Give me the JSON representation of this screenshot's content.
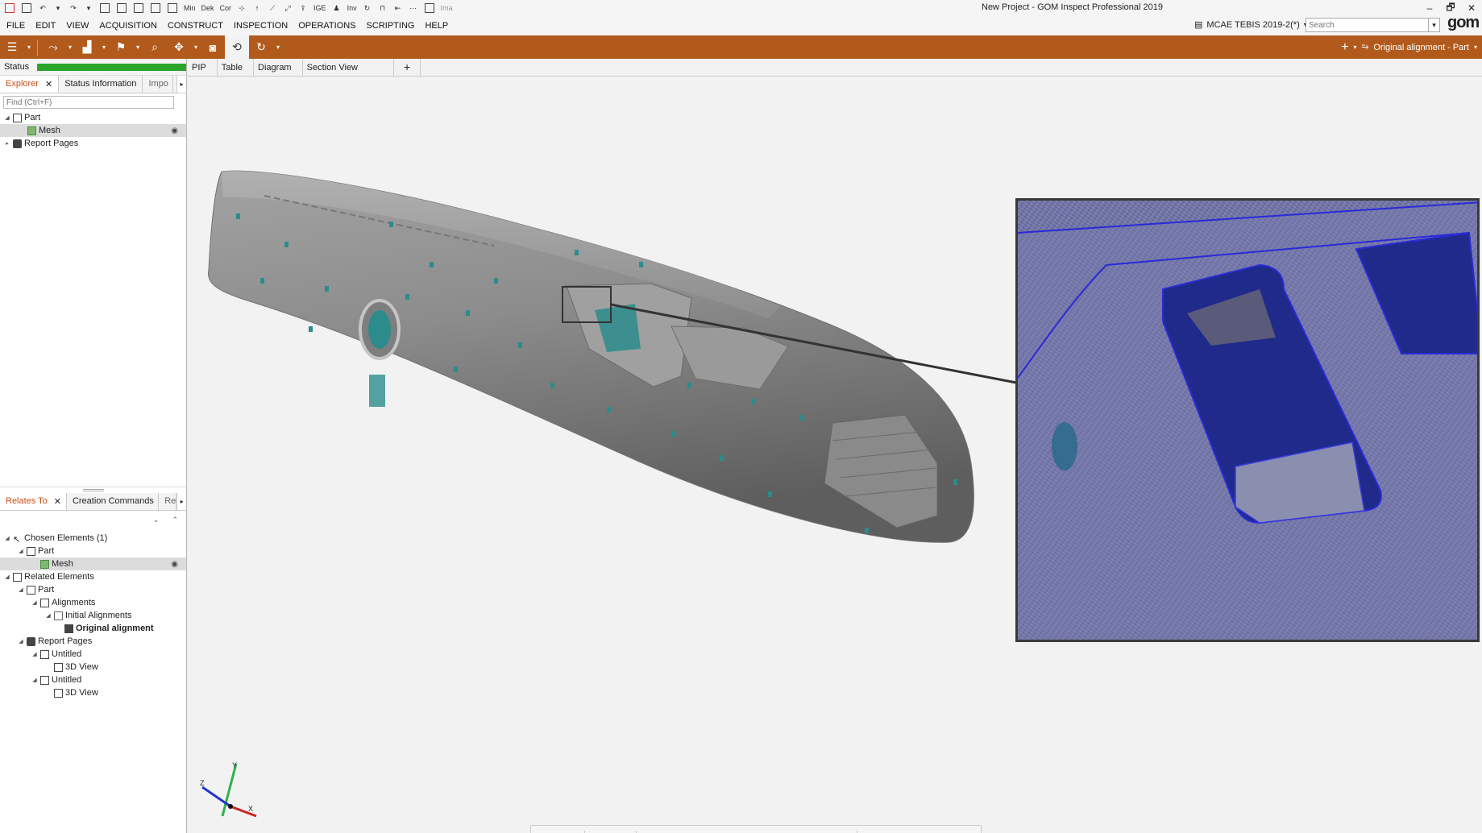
{
  "window": {
    "title": "New Project - GOM Inspect Professional 2019",
    "quick_access": [
      "Min",
      "Dek",
      "Cor",
      "IGE",
      "Inv",
      "Ima"
    ],
    "controls": [
      "–",
      "🗗",
      "✕"
    ]
  },
  "menu": [
    "FILE",
    "EDIT",
    "VIEW",
    "ACQUISITION",
    "CONSTRUCT",
    "INSPECTION",
    "OPERATIONS",
    "SCRIPTING",
    "HELP"
  ],
  "project": {
    "name": "MCAE TEBIS 2019-2(*)",
    "search_placeholder": "Search",
    "logo": "gom"
  },
  "toolbar": {
    "alignment": "Original alignment - Part"
  },
  "status": {
    "label": "Status",
    "progress": 1.0,
    "color": "#2aa52a"
  },
  "explorer": {
    "tabs": [
      "Explorer",
      "Status Information",
      "Impo"
    ],
    "find_placeholder": "Find (Ctrl+F)",
    "tree": [
      {
        "label": "Part",
        "level": 0,
        "icon": "part-icon",
        "expanded": true
      },
      {
        "label": "Mesh",
        "level": 1,
        "icon": "mesh-icon",
        "selected": true,
        "visible": true
      },
      {
        "label": "Report Pages",
        "level": 0,
        "icon": "camera-icon",
        "expanded": false
      }
    ]
  },
  "relates": {
    "tabs": [
      "Relates To",
      "Creation Commands",
      "Re"
    ],
    "tree": [
      {
        "label": "Chosen Elements (1)",
        "level": 0,
        "icon": "cursor-icon",
        "expanded": true
      },
      {
        "label": "Part",
        "level": 1,
        "icon": "part-icon",
        "expanded": true
      },
      {
        "label": "Mesh",
        "level": 2,
        "icon": "mesh-icon",
        "selected": true,
        "visible": true
      },
      {
        "label": "Related Elements",
        "level": 0,
        "icon": "hierarchy-icon",
        "expanded": true
      },
      {
        "label": "Part",
        "level": 1,
        "icon": "part-icon",
        "expanded": true
      },
      {
        "label": "Alignments",
        "level": 2,
        "icon": "alignment-icon",
        "expanded": true
      },
      {
        "label": "Initial Alignments",
        "level": 3,
        "icon": "folder-icon",
        "expanded": true
      },
      {
        "label": "Original alignment",
        "level": 4,
        "icon": "check-icon",
        "bold": true
      },
      {
        "label": "Report Pages",
        "level": 1,
        "icon": "camera-icon",
        "expanded": true
      },
      {
        "label": "Untitled",
        "level": 2,
        "icon": "page-icon",
        "expanded": true
      },
      {
        "label": "3D View",
        "level": 3,
        "icon": "view-icon"
      },
      {
        "label": "Untitled",
        "level": 2,
        "icon": "page-icon",
        "expanded": true
      },
      {
        "label": "3D View",
        "level": 3,
        "icon": "view-icon"
      }
    ]
  },
  "view_tabs": [
    "PIP",
    "Table",
    "Diagram",
    "Section View",
    "+"
  ],
  "axes": {
    "x": "X",
    "y": "Y",
    "z": "Z"
  },
  "colors": {
    "accent": "#b25a1c",
    "mesh_grey": "#8a8a8a",
    "marker_teal": "#2c8c8c",
    "inset_blue": "#6f73a8"
  }
}
